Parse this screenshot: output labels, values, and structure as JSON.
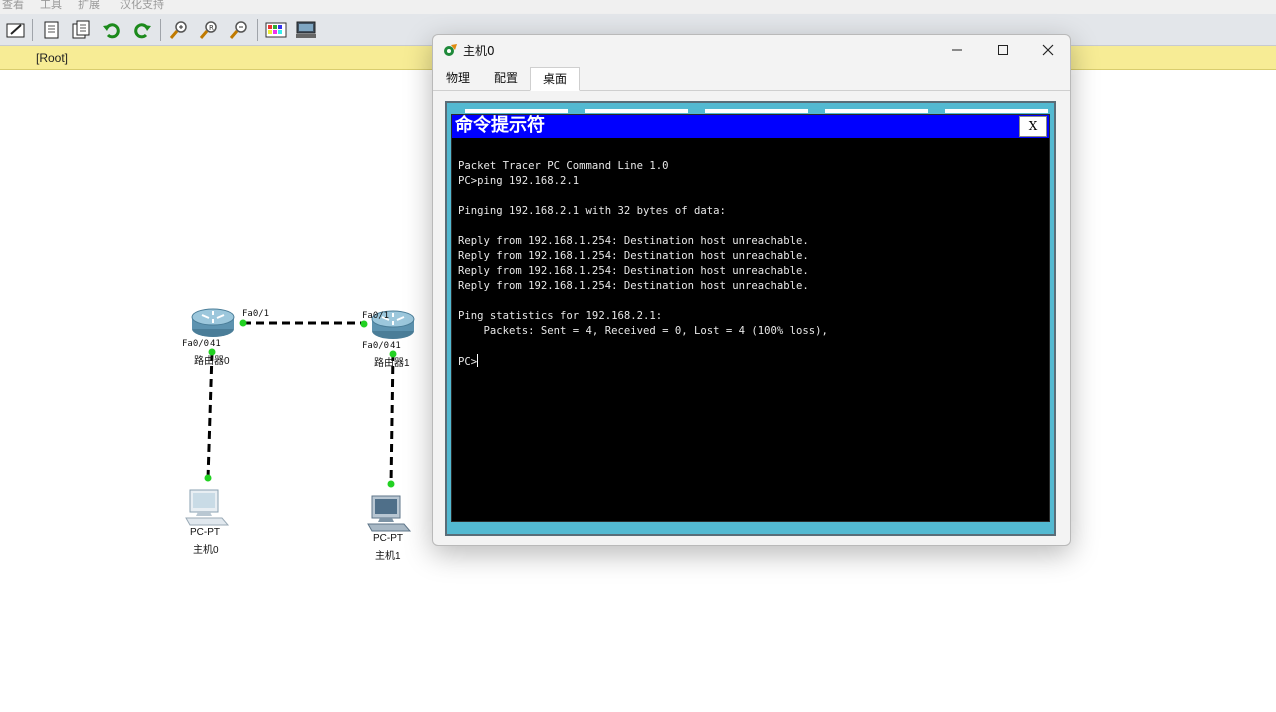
{
  "menubar": {
    "items": [
      "查看",
      "工具",
      "扩展",
      "汉化支持"
    ]
  },
  "toolbar": {
    "icons": [
      "new-icon",
      "copy-icon",
      "paste-icon",
      "undo-icon",
      "redo-icon",
      "zoom-in-icon",
      "zoom-reset-icon",
      "zoom-out-icon",
      "palette-icon",
      "device-dialog-icon"
    ]
  },
  "workspace": {
    "root_label": "[Root]"
  },
  "topology": {
    "router0": {
      "name": "路由器0",
      "port_top": "Fa0/1",
      "port_bottom": "Fa0/0"
    },
    "router1": {
      "name": "路由器1",
      "port_top": "Fa0/1",
      "port_bottom": "Fa0/0"
    },
    "pc0": {
      "type": "PC-PT",
      "name": "主机0"
    },
    "pc1": {
      "type": "PC-PT",
      "name": "主机1"
    },
    "link_color": "#000000",
    "link_status_color": "#22d122"
  },
  "dialog": {
    "title": "主机0",
    "tabs": [
      {
        "label": "物理",
        "active": false
      },
      {
        "label": "配置",
        "active": false
      },
      {
        "label": "桌面",
        "active": true
      }
    ],
    "cmd": {
      "title": "命令提示符",
      "close_label": "X",
      "lines": [
        "Packet Tracer PC Command Line 1.0",
        "PC>ping 192.168.2.1",
        "",
        "Pinging 192.168.2.1 with 32 bytes of data:",
        "",
        "Reply from 192.168.1.254: Destination host unreachable.",
        "Reply from 192.168.1.254: Destination host unreachable.",
        "Reply from 192.168.1.254: Destination host unreachable.",
        "Reply from 192.168.1.254: Destination host unreachable.",
        "",
        "Ping statistics for 192.168.2.1:",
        "    Packets: Sent = 4, Received = 0, Lost = 4 (100% loss),",
        ""
      ],
      "prompt": "PC>"
    },
    "colors": {
      "cmd_title_bg": "#0000ff",
      "desktop_bg": "#53b9d1"
    }
  }
}
